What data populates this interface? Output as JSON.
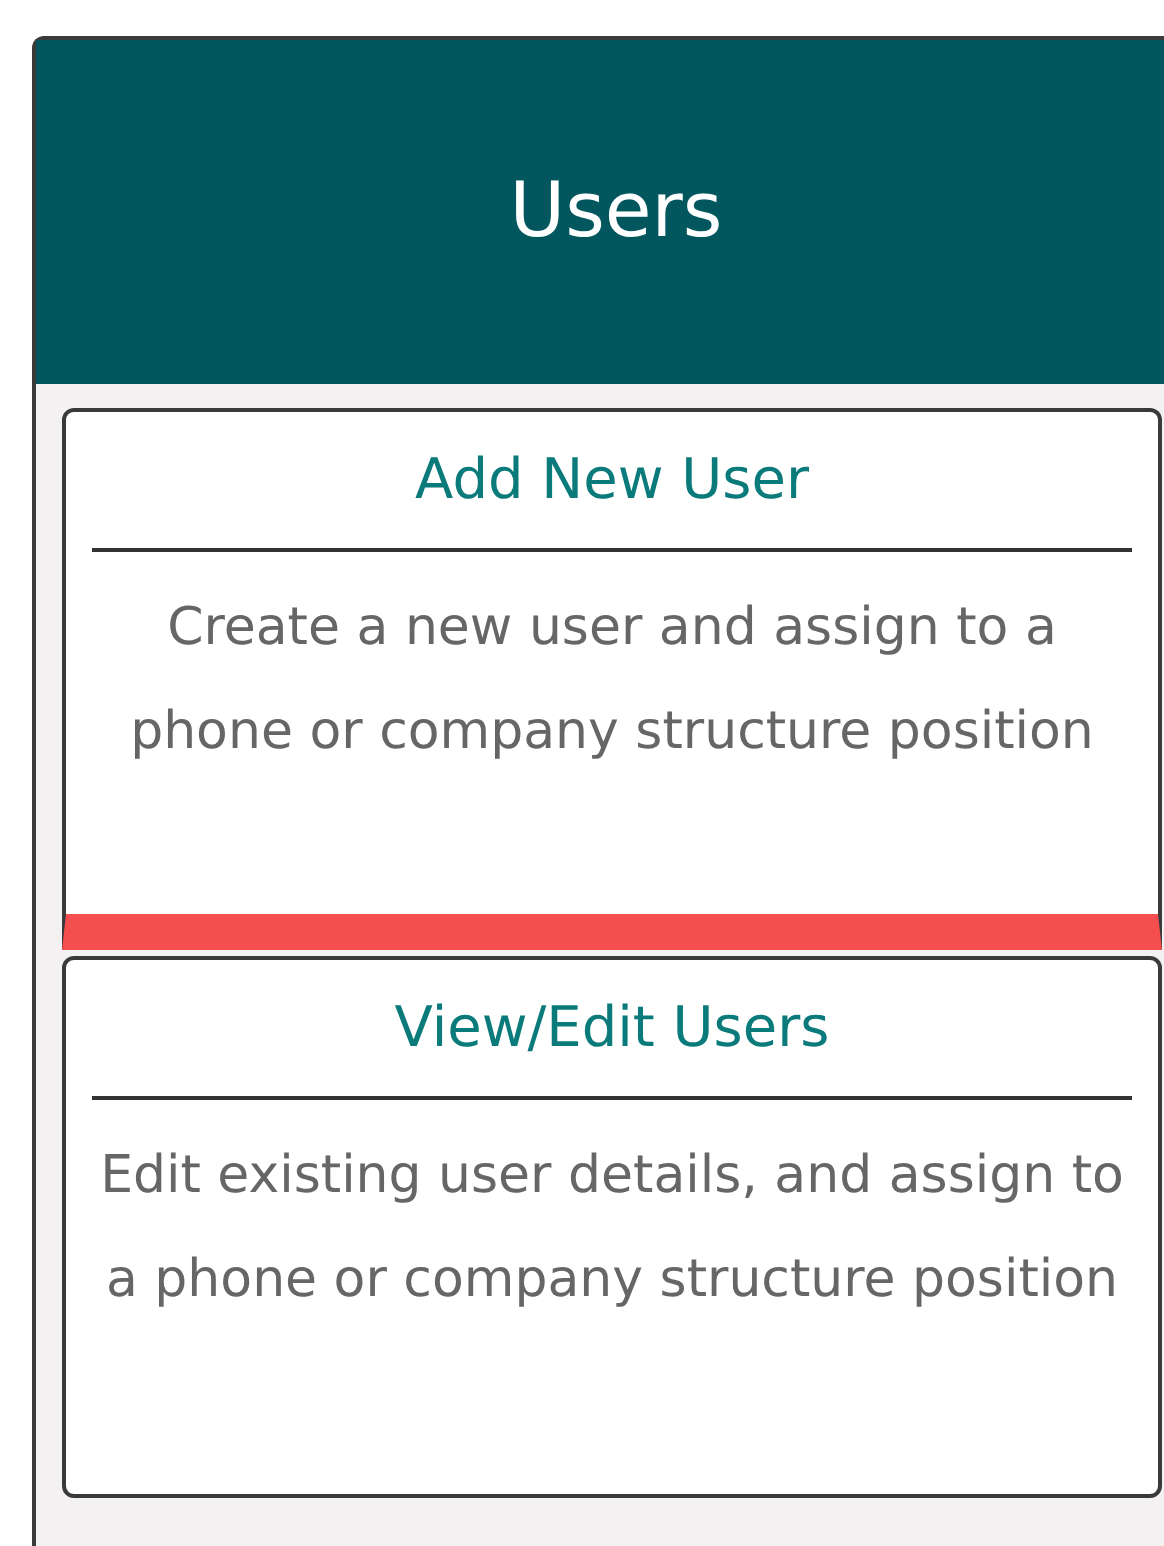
{
  "header": {
    "title": "Users"
  },
  "cards": [
    {
      "title": "Add New User",
      "description": "Create a new user and assign to a phone or company structure position",
      "selected": true
    },
    {
      "title": "View/Edit Users",
      "description": "Edit existing user details, and assign to a phone or company structure position",
      "selected": false
    }
  ]
}
